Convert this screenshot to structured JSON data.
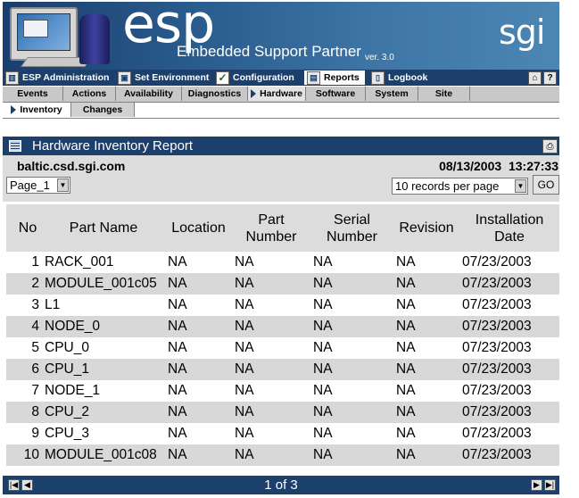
{
  "banner": {
    "brand": "esp",
    "tagline": "Embedded Support Partner",
    "version": "ver. 3.0",
    "logo": "sgi"
  },
  "topnav": {
    "items": [
      {
        "label": "ESP Administration",
        "icon": "server-icon"
      },
      {
        "label": "Set Environment",
        "icon": "monitor-icon"
      },
      {
        "label": "Configuration",
        "icon": "checkmark-icon"
      },
      {
        "label": "Reports",
        "icon": "report-icon"
      },
      {
        "label": "Logbook",
        "icon": "book-icon"
      }
    ],
    "home_label": "⌂",
    "help_label": "?"
  },
  "subnav": [
    "Events",
    "Actions",
    "Availability",
    "Diagnostics",
    "Hardware",
    "Software",
    "System",
    "Site"
  ],
  "subnav2": [
    "Inventory",
    "Changes"
  ],
  "report": {
    "title": "Hardware Inventory Report",
    "host": "baltic.csd.sgi.com",
    "date": "08/13/2003",
    "time": "13:27:33",
    "page_select": "Page_1",
    "records_select": "10 records per page",
    "go_label": "GO",
    "columns": [
      {
        "line1": "No",
        "line2": ""
      },
      {
        "line1": "Part Name",
        "line2": ""
      },
      {
        "line1": "Location",
        "line2": ""
      },
      {
        "line1": "Part",
        "line2": "Number"
      },
      {
        "line1": "Serial",
        "line2": "Number"
      },
      {
        "line1": "Revision",
        "line2": ""
      },
      {
        "line1": "Installation",
        "line2": "Date"
      }
    ],
    "rows": [
      {
        "no": "1",
        "name": "RACK_001",
        "location": "NA",
        "part": "NA",
        "serial": "NA",
        "revision": "NA",
        "date": "07/23/2003"
      },
      {
        "no": "2",
        "name": "MODULE_001c05",
        "location": "NA",
        "part": "NA",
        "serial": "NA",
        "revision": "NA",
        "date": "07/23/2003"
      },
      {
        "no": "3",
        "name": "L1",
        "location": "NA",
        "part": "NA",
        "serial": "NA",
        "revision": "NA",
        "date": "07/23/2003"
      },
      {
        "no": "4",
        "name": "NODE_0",
        "location": "NA",
        "part": "NA",
        "serial": "NA",
        "revision": "NA",
        "date": "07/23/2003"
      },
      {
        "no": "5",
        "name": "CPU_0",
        "location": "NA",
        "part": "NA",
        "serial": "NA",
        "revision": "NA",
        "date": "07/23/2003"
      },
      {
        "no": "6",
        "name": "CPU_1",
        "location": "NA",
        "part": "NA",
        "serial": "NA",
        "revision": "NA",
        "date": "07/23/2003"
      },
      {
        "no": "7",
        "name": "NODE_1",
        "location": "NA",
        "part": "NA",
        "serial": "NA",
        "revision": "NA",
        "date": "07/23/2003"
      },
      {
        "no": "8",
        "name": "CPU_2",
        "location": "NA",
        "part": "NA",
        "serial": "NA",
        "revision": "NA",
        "date": "07/23/2003"
      },
      {
        "no": "9",
        "name": "CPU_3",
        "location": "NA",
        "part": "NA",
        "serial": "NA",
        "revision": "NA",
        "date": "07/23/2003"
      },
      {
        "no": "10",
        "name": "MODULE_001c08",
        "location": "NA",
        "part": "NA",
        "serial": "NA",
        "revision": "NA",
        "date": "07/23/2003"
      }
    ],
    "pager": "1 of 3"
  }
}
